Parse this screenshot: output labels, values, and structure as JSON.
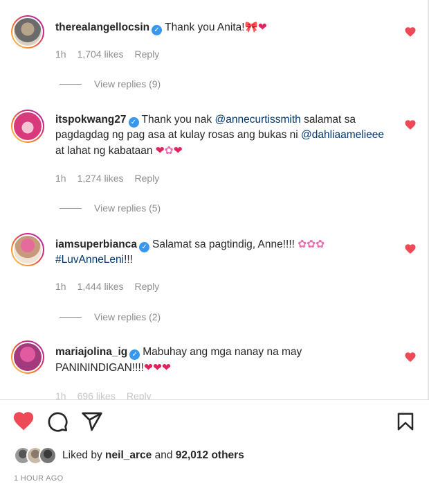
{
  "colors": {
    "like_red": "#ed4956",
    "mention_blue": "#00376b",
    "muted": "#8e8e8e",
    "verified_blue": "#3897f0"
  },
  "comments": [
    {
      "username": "therealangellocsin",
      "segments": [
        {
          "type": "text",
          "value": "Thank you Anita!"
        },
        {
          "type": "emoji",
          "value": "🎀",
          "icon": "bow-emoji"
        },
        {
          "type": "emoji",
          "value": "❤",
          "icon": "heart-emoji"
        }
      ],
      "time": "1h",
      "likes": "1,704 likes",
      "reply": "Reply",
      "view_replies": "View replies (9)",
      "liked": true
    },
    {
      "username": "itspokwang27",
      "segments": [
        {
          "type": "text",
          "value": "Thank you nak "
        },
        {
          "type": "mention",
          "value": "@annecurtissmith"
        },
        {
          "type": "text",
          "value": " salamat sa pagdagdag ng pag asa at kulay rosas ang bukas ni "
        },
        {
          "type": "mention",
          "value": "@dahliaamelieee"
        },
        {
          "type": "text",
          "value": " at lahat ng kabataan "
        },
        {
          "type": "emoji",
          "value": "❤",
          "icon": "heart-emoji"
        },
        {
          "type": "emoji",
          "value": "✿",
          "icon": "flower-emoji"
        },
        {
          "type": "emoji",
          "value": "❤",
          "icon": "heart-emoji"
        }
      ],
      "time": "1h",
      "likes": "1,274 likes",
      "reply": "Reply",
      "view_replies": "View replies (5)",
      "liked": true
    },
    {
      "username": "iamsuperbianca",
      "segments": [
        {
          "type": "text",
          "value": "Salamat sa pagtindig, Anne!!!! "
        },
        {
          "type": "emoji",
          "value": "✿",
          "icon": "flower-emoji"
        },
        {
          "type": "emoji",
          "value": "✿",
          "icon": "flower-emoji"
        },
        {
          "type": "emoji",
          "value": "✿",
          "icon": "flower-emoji"
        },
        {
          "type": "text",
          "value": " "
        },
        {
          "type": "mention",
          "value": "#LuvAnneLeni"
        },
        {
          "type": "text",
          "value": "!!!"
        }
      ],
      "time": "1h",
      "likes": "1,444 likes",
      "reply": "Reply",
      "view_replies": "View replies (2)",
      "liked": true
    },
    {
      "username": "mariajolina_ig",
      "segments": [
        {
          "type": "text",
          "value": "Mabuhay ang mga nanay na may PANININDIGAN!!!!"
        },
        {
          "type": "emoji",
          "value": "❤",
          "icon": "heart-emoji"
        },
        {
          "type": "emoji",
          "value": "❤",
          "icon": "heart-emoji"
        },
        {
          "type": "emoji",
          "value": "❤",
          "icon": "heart-emoji"
        }
      ],
      "time": "1h",
      "likes": "696 likes",
      "reply": "Reply",
      "liked": true
    }
  ],
  "footer": {
    "liked_by_prefix": "Liked by ",
    "liked_by_user": "neil_arce",
    "liked_by_middle": " and ",
    "liked_by_count": "92,012 others",
    "timestamp": "1 HOUR AGO"
  },
  "icons": [
    "heart-filled-icon",
    "comment-icon",
    "share-icon",
    "bookmark-icon",
    "verified-badge-icon"
  ]
}
